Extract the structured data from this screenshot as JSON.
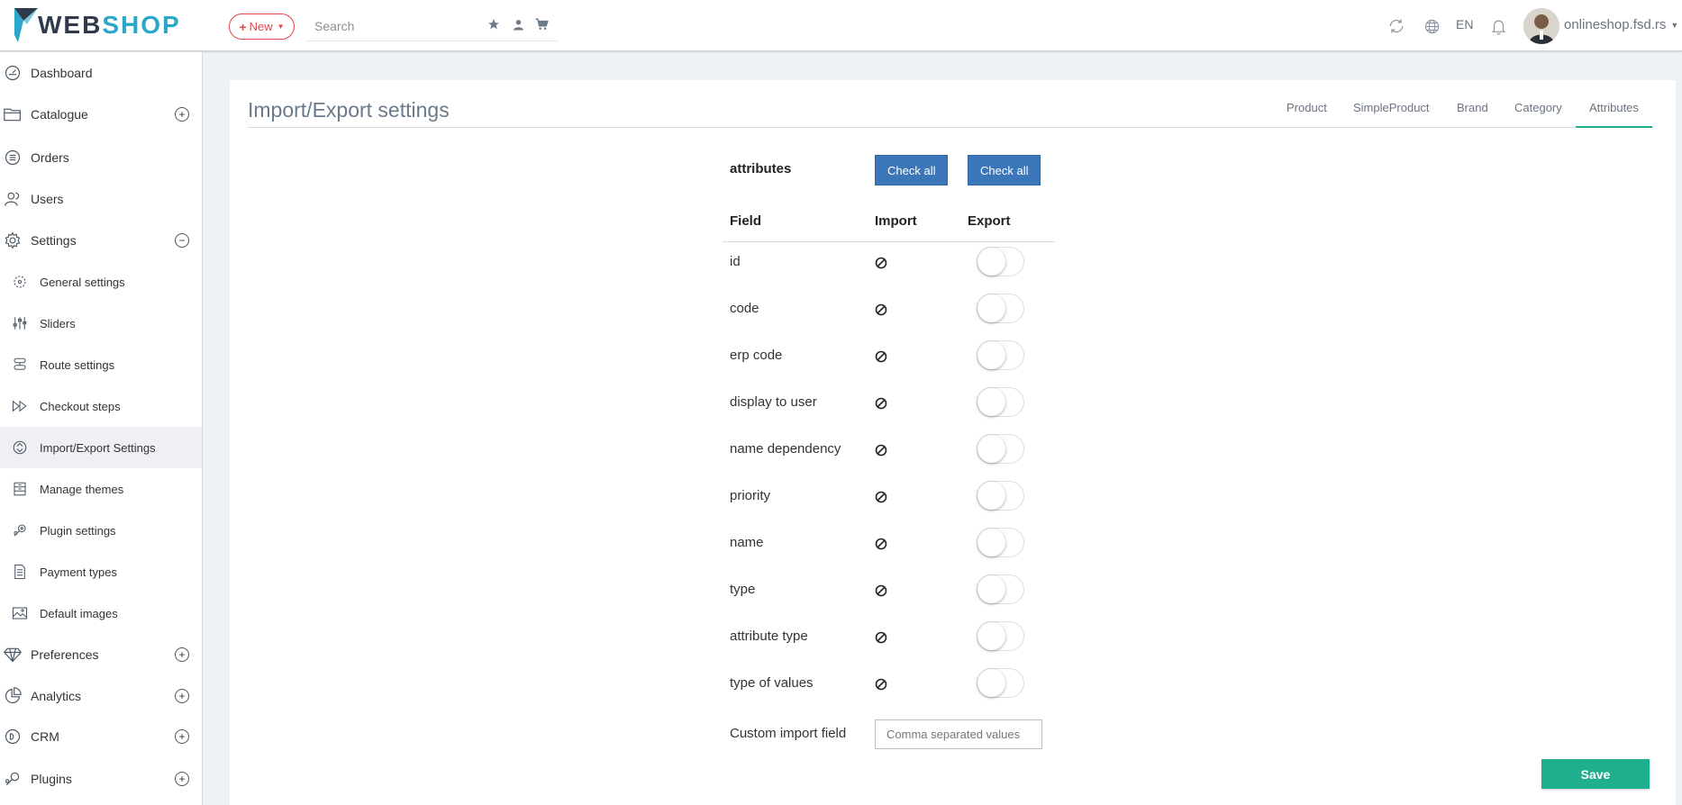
{
  "header": {
    "logo_part1": "WEB",
    "logo_part2": "SHOP",
    "new_label": "New",
    "search_placeholder": "Search",
    "language": "EN",
    "username": "onlineshop.fsd.rs"
  },
  "sidebar": {
    "dashboard": "Dashboard",
    "catalogue": "Catalogue",
    "orders": "Orders",
    "users": "Users",
    "settings": "Settings",
    "settings_items": [
      "General settings",
      "Sliders",
      "Route settings",
      "Checkout steps",
      "Import/Export Settings",
      "Manage themes",
      "Plugin settings",
      "Payment types",
      "Default images"
    ],
    "preferences": "Preferences",
    "analytics": "Analytics",
    "crm": "CRM",
    "plugins": "Plugins"
  },
  "main": {
    "title": "Import/Export settings",
    "tabs": [
      "Product",
      "SimpleProduct",
      "Brand",
      "Category",
      "Attributes"
    ],
    "active_tab": "Attributes",
    "section_title": "attributes",
    "check_all_import": "Check all",
    "check_all_export": "Check all",
    "columns": {
      "field": "Field",
      "import": "Import",
      "export": "Export"
    },
    "fields": [
      {
        "name": "id",
        "import": "disabled",
        "export": false
      },
      {
        "name": "code",
        "import": "disabled",
        "export": false
      },
      {
        "name": "erp code",
        "import": "disabled",
        "export": false
      },
      {
        "name": "display to user",
        "import": "disabled",
        "export": false
      },
      {
        "name": "name dependency",
        "import": "disabled",
        "export": false
      },
      {
        "name": "priority",
        "import": "disabled",
        "export": false
      },
      {
        "name": "name",
        "import": "disabled",
        "export": false
      },
      {
        "name": "type",
        "import": "disabled",
        "export": false
      },
      {
        "name": "attribute type",
        "import": "disabled",
        "export": false
      },
      {
        "name": "type of values",
        "import": "disabled",
        "export": false
      }
    ],
    "custom_import_label": "Custom import field",
    "custom_import_placeholder": "Comma separated values",
    "save_label": "Save"
  },
  "colors": {
    "brand_dark": "#2f3b4a",
    "brand_light": "#2aa7c9",
    "new_button": "#e0474c",
    "primary_button": "#3a76b8",
    "accent": "#1fae8e"
  }
}
